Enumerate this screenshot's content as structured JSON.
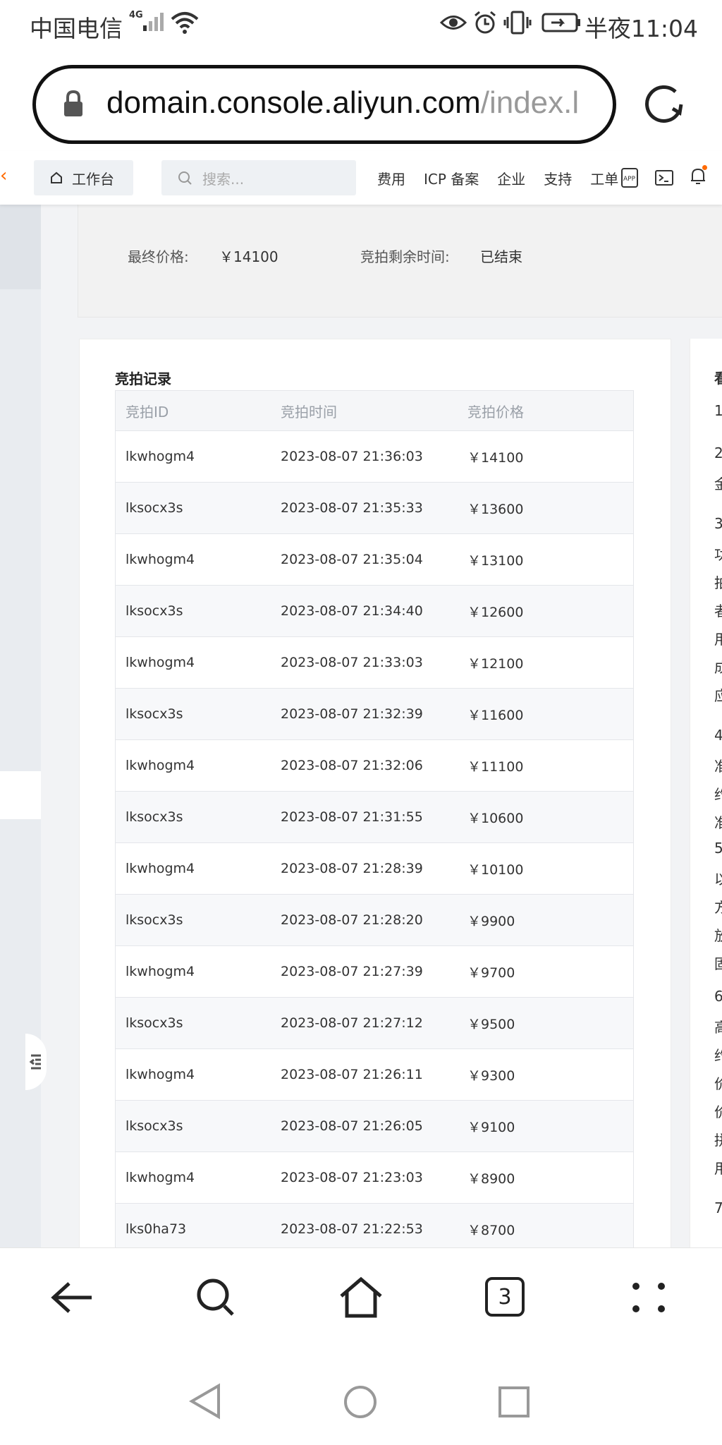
{
  "status_bar": {
    "carrier": "中国电信",
    "network": "4G",
    "time": "半夜11:04",
    "icons": [
      "signal-icon",
      "wifi-icon",
      "eye-icon",
      "alarm-icon",
      "vibrate-icon",
      "battery-icon"
    ]
  },
  "browser": {
    "url_main": "domain.console.aliyun.com",
    "url_rest": "/index.l",
    "tab_count": "3"
  },
  "top_nav": {
    "workbench": "工作台",
    "search_placeholder": "搜索...",
    "links": [
      "费用",
      "ICP 备案",
      "企业",
      "支持",
      "工单"
    ]
  },
  "info": {
    "final_price_label": "最终价格:",
    "final_price_value": "￥14100",
    "remaining_label": "竞拍剩余时间:",
    "remaining_value": "已结束"
  },
  "records": {
    "title": "竞拍记录",
    "columns": [
      "竞拍ID",
      "竞拍时间",
      "竞拍价格"
    ],
    "rows": [
      {
        "id": "lkwhogm4",
        "time": "2023-08-07 21:36:03",
        "price": "￥14100"
      },
      {
        "id": "lksocx3s",
        "time": "2023-08-07 21:35:33",
        "price": "￥13600"
      },
      {
        "id": "lkwhogm4",
        "time": "2023-08-07 21:35:04",
        "price": "￥13100"
      },
      {
        "id": "lksocx3s",
        "time": "2023-08-07 21:34:40",
        "price": "￥12600"
      },
      {
        "id": "lkwhogm4",
        "time": "2023-08-07 21:33:03",
        "price": "￥12100"
      },
      {
        "id": "lksocx3s",
        "time": "2023-08-07 21:32:39",
        "price": "￥11600"
      },
      {
        "id": "lkwhogm4",
        "time": "2023-08-07 21:32:06",
        "price": "￥11100"
      },
      {
        "id": "lksocx3s",
        "time": "2023-08-07 21:31:55",
        "price": "￥10600"
      },
      {
        "id": "lkwhogm4",
        "time": "2023-08-07 21:28:39",
        "price": "￥10100"
      },
      {
        "id": "lksocx3s",
        "time": "2023-08-07 21:28:20",
        "price": "￥9900"
      },
      {
        "id": "lkwhogm4",
        "time": "2023-08-07 21:27:39",
        "price": "￥9700"
      },
      {
        "id": "lksocx3s",
        "time": "2023-08-07 21:27:12",
        "price": "￥9500"
      },
      {
        "id": "lkwhogm4",
        "time": "2023-08-07 21:26:11",
        "price": "￥9300"
      },
      {
        "id": "lksocx3s",
        "time": "2023-08-07 21:26:05",
        "price": "￥9100"
      },
      {
        "id": "lkwhogm4",
        "time": "2023-08-07 21:23:03",
        "price": "￥8900"
      },
      {
        "id": "lks0ha73",
        "time": "2023-08-07 21:22:53",
        "price": "￥8700"
      }
    ]
  },
  "right_panel_fragments": [
    "看",
    "1",
    "2",
    "金",
    "3",
    "功",
    "拍",
    "者",
    "用",
    "成",
    "应",
    "4",
    "准",
    "约",
    "准",
    "5",
    "以",
    "方",
    "放",
    "固",
    "6",
    "高",
    "约",
    "价",
    "价",
    "拼",
    "用",
    "7"
  ],
  "colors": {
    "brand_orange": "#ff6a00",
    "page_bg": "#f2f3f5"
  }
}
